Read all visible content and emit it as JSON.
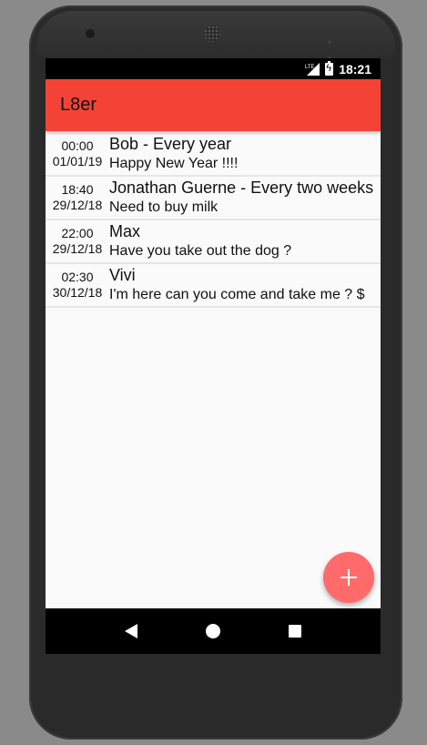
{
  "status_bar": {
    "network": "LTE",
    "time": "18:21"
  },
  "app_bar": {
    "title": "L8er"
  },
  "reminders": [
    {
      "time": "00:00",
      "date": "01/01/19",
      "title": "Bob - Every year",
      "body": "Happy New Year !!!!"
    },
    {
      "time": "18:40",
      "date": "29/12/18",
      "title": "Jonathan Guerne - Every two weeks",
      "body": "Need to buy milk"
    },
    {
      "time": "22:00",
      "date": "29/12/18",
      "title": "Max",
      "body": "Have you take out the dog ?"
    },
    {
      "time": "02:30",
      "date": "30/12/18",
      "title": "Vivi",
      "body": "I'm here can you come and take me ? $"
    }
  ],
  "fab": {
    "icon": "plus-icon"
  },
  "navigation": {
    "back_icon": "back-triangle-icon",
    "home_icon": "home-circle-icon",
    "recents_icon": "recents-square-icon"
  },
  "colors": {
    "app_bar": "#f44336",
    "fab": "#ff6b6b"
  }
}
